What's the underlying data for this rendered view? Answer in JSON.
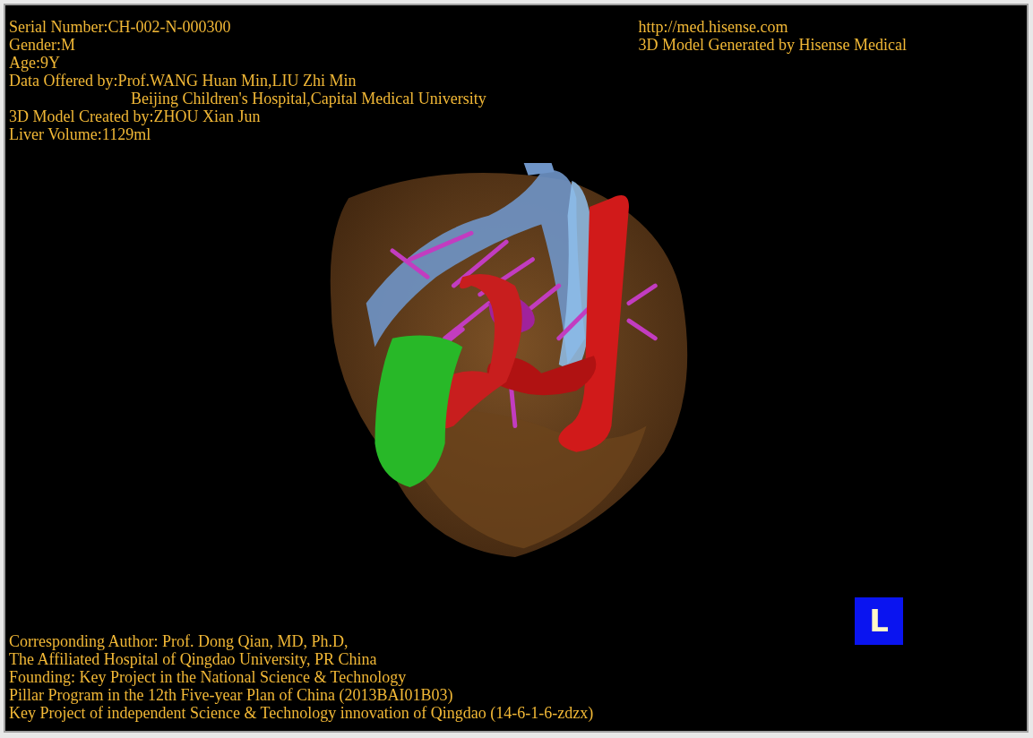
{
  "info_top_left": [
    {
      "kind": "line",
      "text": "Serial Number:CH-002-N-000300"
    },
    {
      "kind": "line",
      "text": "Gender:M"
    },
    {
      "kind": "line",
      "text": "Age:9Y"
    },
    {
      "kind": "line",
      "text": "Data Offered by:Prof.WANG Huan Min,LIU Zhi Min"
    },
    {
      "kind": "continuation",
      "text": "Beijing Children's Hospital,Capital Medical University"
    },
    {
      "kind": "line",
      "text": "3D Model Created by:ZHOU Xian Jun"
    },
    {
      "kind": "line",
      "text": "Liver Volume:1129ml"
    }
  ],
  "info_top_right": [
    "http://med.hisense.com",
    "3D Model Generated by Hisense Medical"
  ],
  "model": {
    "kind": "liver"
  },
  "orientation_marker": "L",
  "credits": [
    "Corresponding Author: Prof. Dong Qian, MD, Ph.D,",
    "The Affiliated Hospital of Qingdao University, PR China",
    "Founding: Key Project in the National Science & Technology",
    "Pillar Program in the 12th Five-year Plan of China (2013BAI01B03)",
    "Key Project of independent Science & Technology innovation of Qingdao (14-6-1-6-zdzx)"
  ]
}
